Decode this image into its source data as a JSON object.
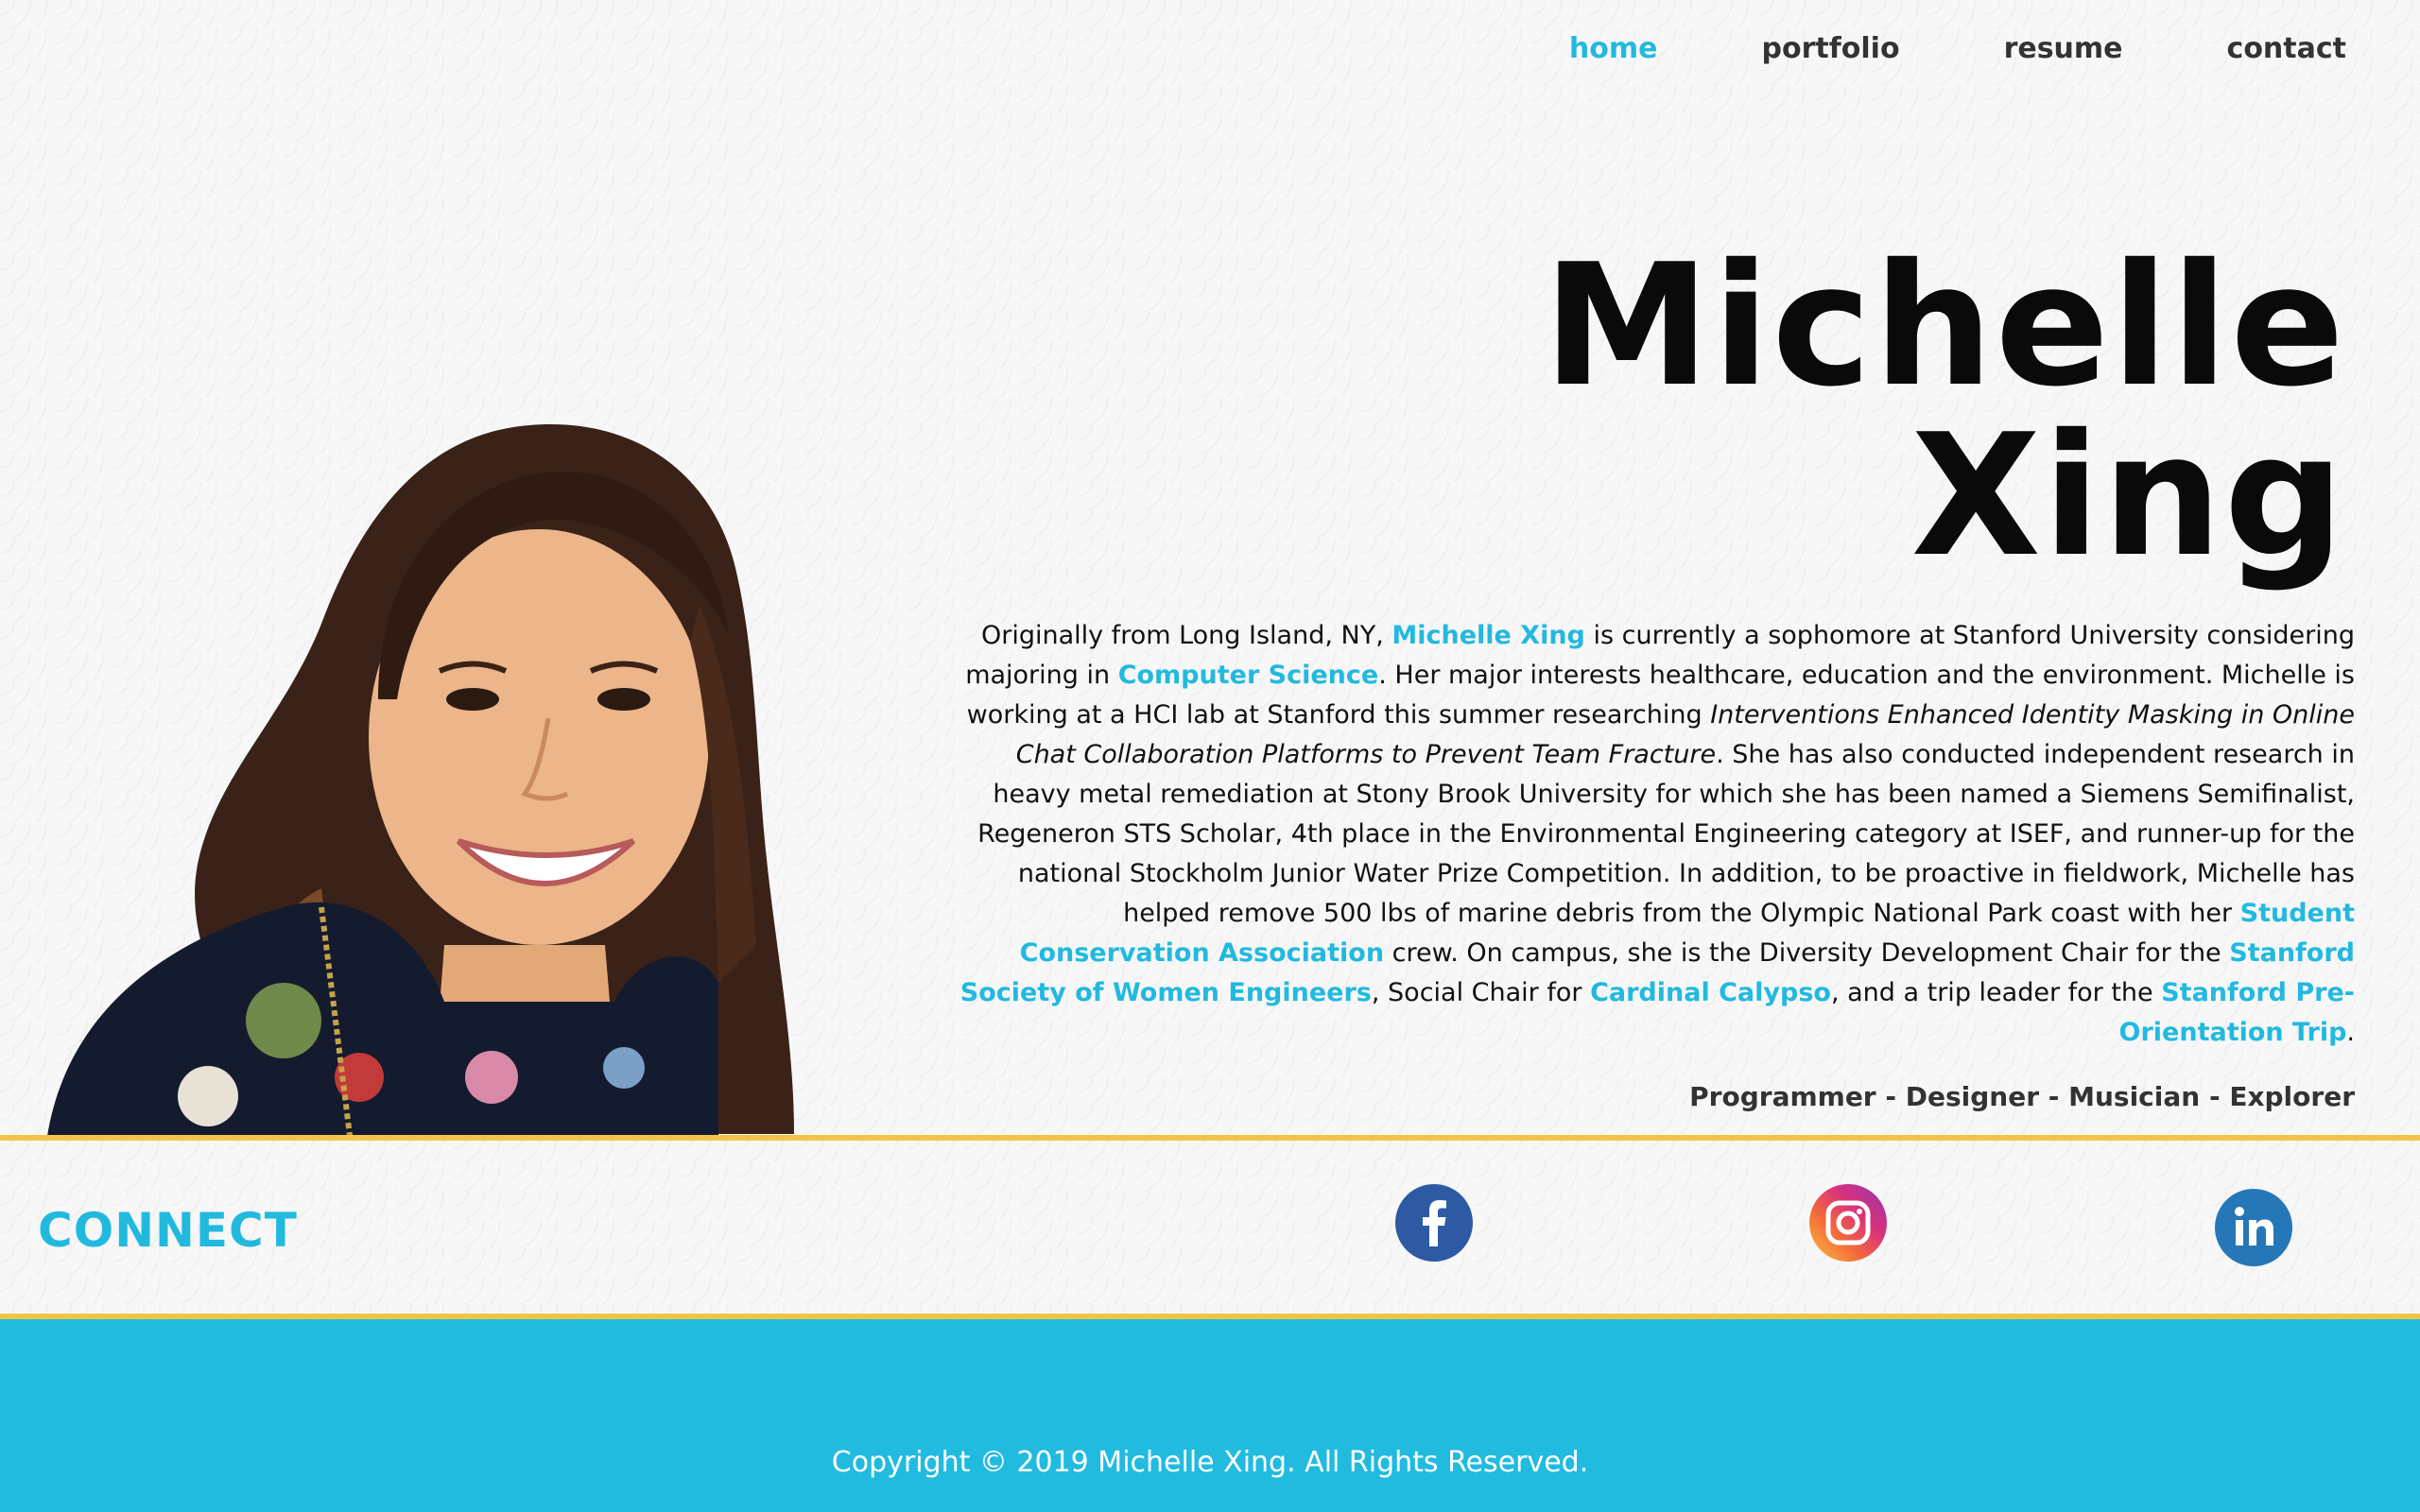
{
  "nav": {
    "items": [
      {
        "label": "home",
        "active": true
      },
      {
        "label": "portfolio",
        "active": false
      },
      {
        "label": "resume",
        "active": false
      },
      {
        "label": "contact",
        "active": false
      }
    ]
  },
  "hero": {
    "name_line1": "Michelle",
    "name_line2": "Xing"
  },
  "bio": {
    "p1": "Originally from Long Island, NY, ",
    "link_name": "Michelle Xing",
    "p2": " is currently a sophomore at Stanford University considering majoring in ",
    "link_major": "Computer Science",
    "p3": ". Her major interests healthcare, education and the environment. Michelle is working at a HCI lab at Stanford this summer researching ",
    "research_title": "Interventions Enhanced Identity Masking in Online Chat Collaboration Platforms to Prevent Team Fracture",
    "p4": ". She has also conducted independent research in heavy metal remediation at Stony Brook University for which she has been named a Siemens Semifinalist, Regeneron STS Scholar, 4th place in the Environmental Engineering category at ISEF, and runner-up for the national Stockholm Junior Water Prize Competition. In addition, to be proactive in fieldwork, Michelle has helped remove 500 lbs of marine debris from the Olympic National Park coast with her ",
    "link_sca": "Student Conservation Association",
    "p5": " crew. On campus, she is the Diversity Development Chair for the ",
    "link_swe": "Stanford Society of Women Engineers",
    "p6": ", Social Chair for ",
    "link_calypso": "Cardinal Calypso",
    "p7": ", and a trip leader for the ",
    "link_spot": "Stanford Pre-Orientation Trip",
    "p8": ".",
    "tagline": "Programmer - Designer - Musician - Explorer"
  },
  "connect": {
    "label": "CONNECT",
    "icons": [
      "facebook-icon",
      "instagram-icon",
      "linkedin-icon"
    ]
  },
  "footer": {
    "copyright": "Copyright © 2019 Michelle Xing. All Rights Reserved."
  },
  "colors": {
    "accent": "#22b9df",
    "gold_line": "#f2c548",
    "footer_bg": "#21bbe0"
  }
}
